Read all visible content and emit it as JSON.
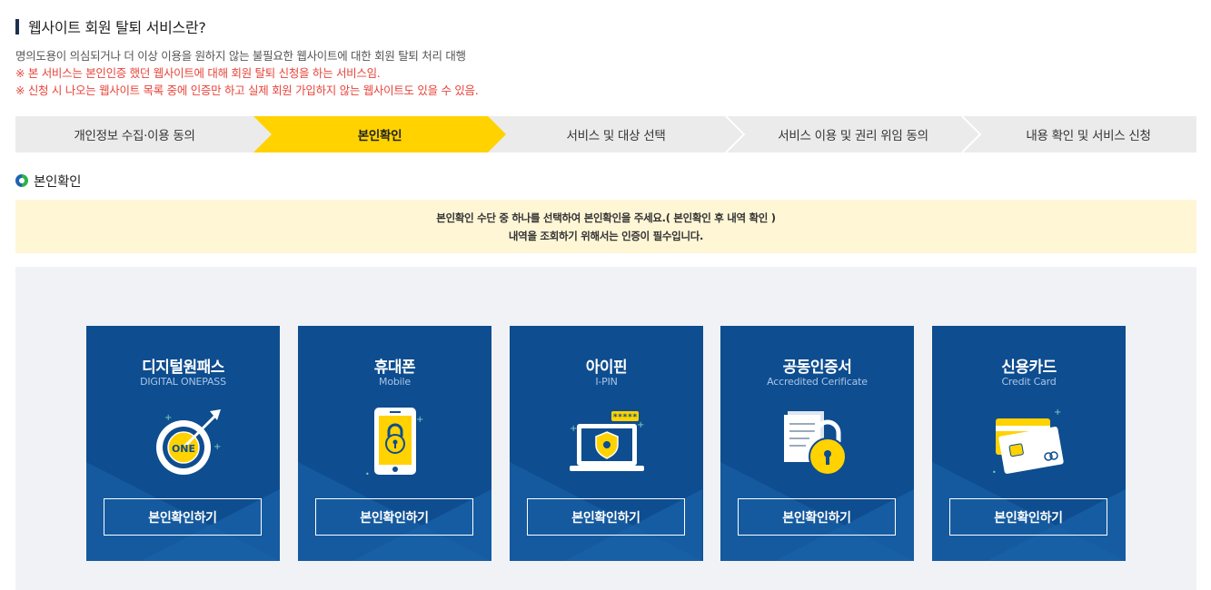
{
  "page_title": "웹사이트 회원 탈퇴 서비스란?",
  "description": {
    "line1": "명의도용이 의심되거나 더 이상 이용을 원하지 않는 불필요한 웹사이트에 대한 회원 탈퇴 처리 대행",
    "line2": "※ 본 서비스는 본인인증 했던 웹사이트에 대해 회원 탈퇴 신청을 하는 서비스임.",
    "line3": "※ 신청 시 나오는 웹사이트 목록 중에 인증만 하고 실제 회원 가입하지 않는 웹사이트도 있을 수 있음."
  },
  "steps": [
    {
      "label": "개인정보 수집·이용 동의"
    },
    {
      "label": "본인확인"
    },
    {
      "label": "서비스 및 대상 선택"
    },
    {
      "label": "서비스 이용 및 권리 위임 동의"
    },
    {
      "label": "내용 확인 및 서비스 신청"
    }
  ],
  "active_step": 1,
  "section_title": "본인확인",
  "notice": {
    "line1": "본인확인 수단 중 하나를 선택하여 본인확인을 주세요.( 본인확인 후 내역 확인 )",
    "line2": "내역을 조회하기 위해서는 인증이 필수입니다."
  },
  "methods": [
    {
      "title": "디지털원패스",
      "subtitle": "DIGITAL ONEPASS",
      "icon": "target-arrow-icon",
      "icon_text": "ONE",
      "button": "본인확인하기"
    },
    {
      "title": "휴대폰",
      "subtitle": "Mobile",
      "icon": "mobile-lock-icon",
      "button": "본인확인하기"
    },
    {
      "title": "아이핀",
      "subtitle": "I-PIN",
      "icon": "laptop-shield-icon",
      "icon_text": "*****",
      "button": "본인확인하기"
    },
    {
      "title": "공동인증서",
      "subtitle": "Accredited Cerificate",
      "icon": "certificate-lock-icon",
      "button": "본인확인하기"
    },
    {
      "title": "신용카드",
      "subtitle": "Credit Card",
      "icon": "credit-card-icon",
      "button": "본인확인하기"
    }
  ],
  "colors": {
    "accent": "#ffd200",
    "card_bg": "#0e4d8f",
    "warning_text": "#e8443a",
    "notice_bg": "#fff6d6"
  }
}
